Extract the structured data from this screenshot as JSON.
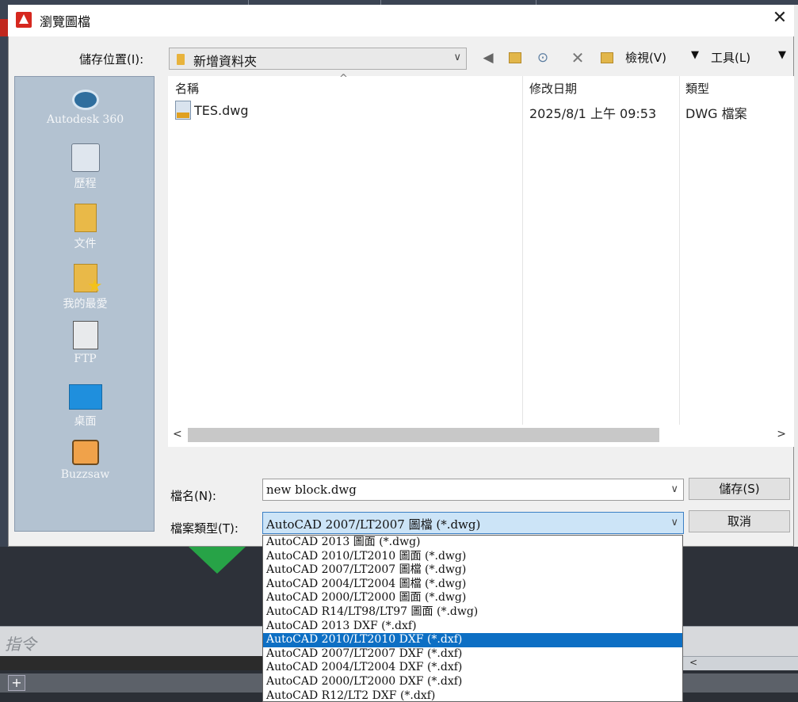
{
  "dialog": {
    "title": "瀏覽圖檔",
    "close_glyph": "✕"
  },
  "toolbar": {
    "save_in_label": "儲存位置(I):",
    "current_folder": "新增資料夾",
    "views_label": "檢視(V)",
    "tools_label": "工具(L)"
  },
  "places": [
    {
      "label": "Autodesk 360",
      "icon": "autodesk-360-icon"
    },
    {
      "label": "歷程",
      "icon": "history-icon"
    },
    {
      "label": "文件",
      "icon": "documents-icon"
    },
    {
      "label": "我的最愛",
      "icon": "favorites-icon"
    },
    {
      "label": "FTP",
      "icon": "ftp-icon"
    },
    {
      "label": "桌面",
      "icon": "desktop-icon"
    },
    {
      "label": "Buzzsaw",
      "icon": "buzzsaw-icon"
    }
  ],
  "file_list": {
    "columns": [
      "名稱",
      "修改日期",
      "類型"
    ],
    "rows": [
      {
        "name": "TES.dwg",
        "modified": "2025/8/1 上午 09:53",
        "type": "DWG 檔案",
        "icon": "dwg-file-icon"
      }
    ]
  },
  "form": {
    "filename_label": "檔名(N):",
    "filename_value": "new block.dwg",
    "filetype_label": "檔案類型(T):",
    "filetype_value": "AutoCAD 2007/LT2007 圖檔 (*.dwg)",
    "save_button": "儲存(S)",
    "cancel_button": "取消"
  },
  "filetype_options": [
    "AutoCAD 2013 圖面 (*.dwg)",
    "AutoCAD 2010/LT2010 圖面 (*.dwg)",
    "AutoCAD 2007/LT2007 圖檔 (*.dwg)",
    "AutoCAD 2004/LT2004 圖檔 (*.dwg)",
    "AutoCAD 2000/LT2000 圖面 (*.dwg)",
    "AutoCAD R14/LT98/LT97 圖面 (*.dwg)",
    "AutoCAD 2013 DXF (*.dxf)",
    "AutoCAD 2010/LT2010 DXF (*.dxf)",
    "AutoCAD 2007/LT2007 DXF (*.dxf)",
    "AutoCAD 2004/LT2004 DXF (*.dxf)",
    "AutoCAD 2000/LT2000 DXF (*.dxf)",
    "AutoCAD R12/LT2 DXF (*.dxf)"
  ],
  "highlighted_option": "AutoCAD 2010/LT2010 DXF (*.dxf)",
  "background_app": {
    "command_line_label": "指令"
  },
  "colors": {
    "selection": "#0d6fc4",
    "places_bar": "#b3c2d1",
    "app_dark": "#2d3139"
  }
}
